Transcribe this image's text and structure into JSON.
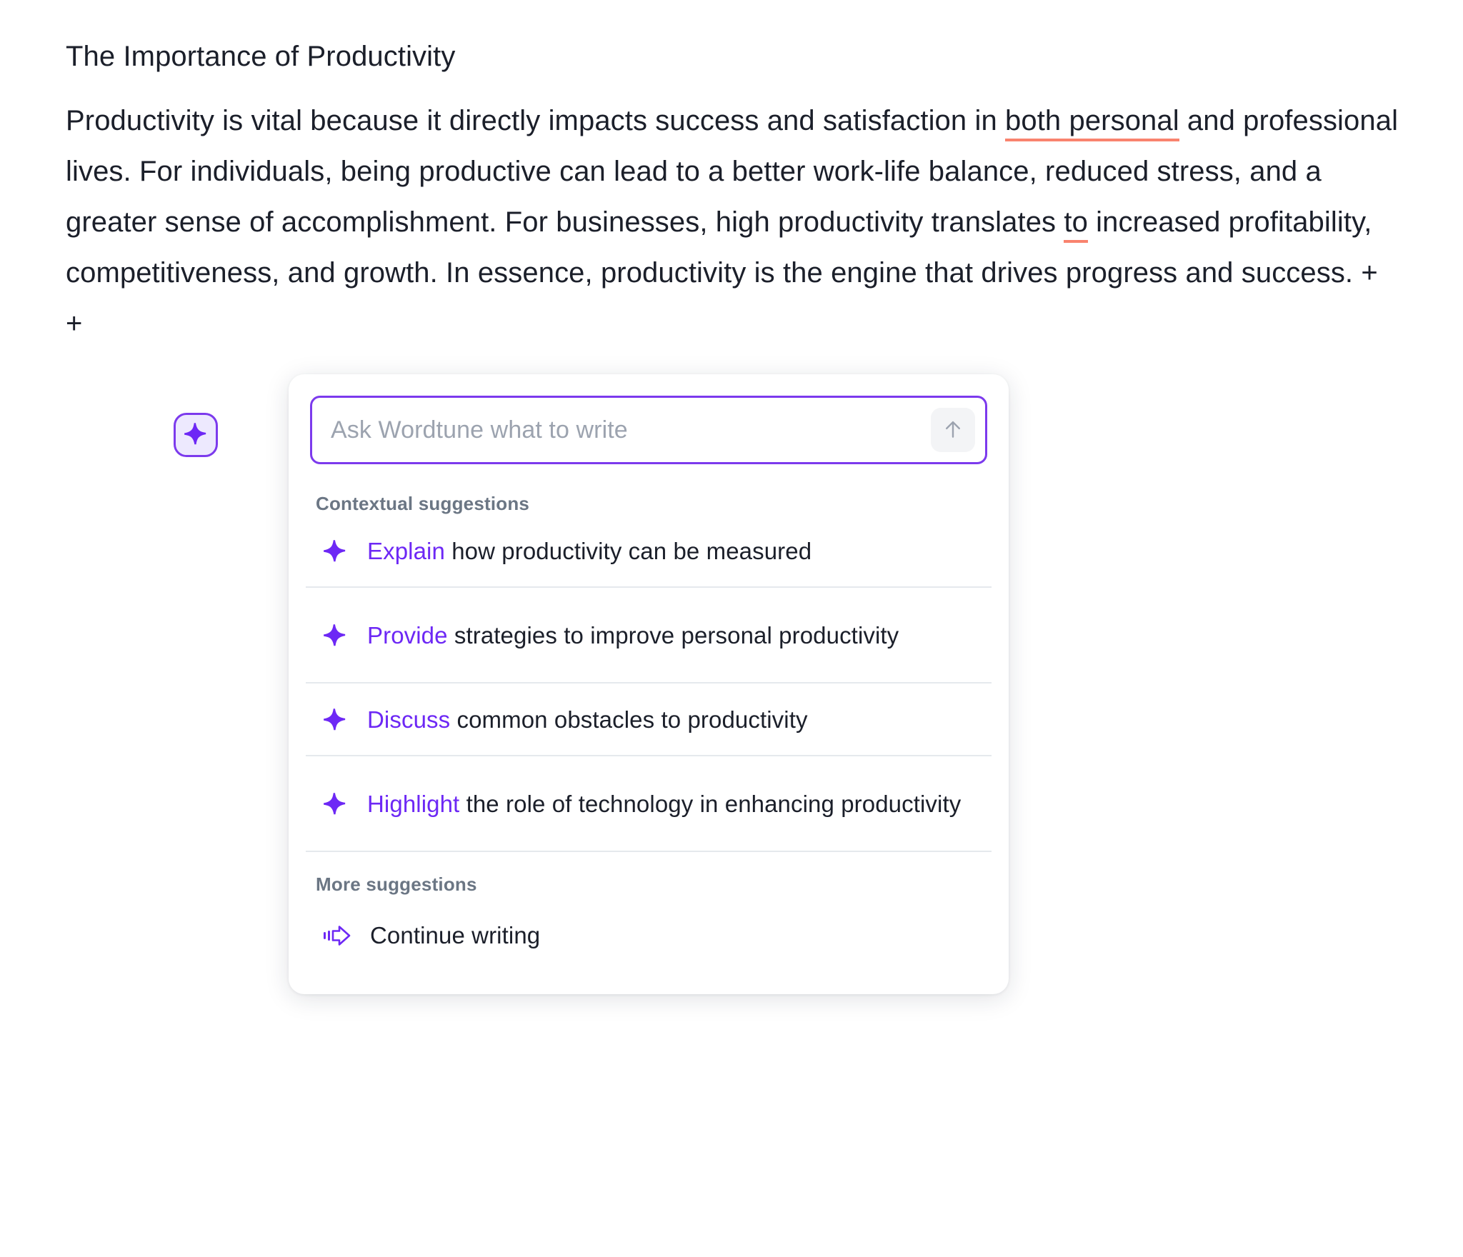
{
  "document": {
    "title": "The Importance of Productivity",
    "paragraph": {
      "part1": "Productivity is vital because it directly impacts success and satisfaction in ",
      "highlight1": "both personal",
      "part2": " and professional lives. For individuals, being productive can lead to a better work-life balance, reduced stress, and a greater sense of accomplishment. For businesses, high productivity translates ",
      "highlight2": "to",
      "part3": " increased profitability, competitiveness, and growth. In essence, productivity is the engine that drives progress and success. + +"
    },
    "suggestion_underline_color": "#f9836e"
  },
  "launcher": {
    "icon": "sparkle-icon",
    "border_color": "#7c3aed",
    "fill_color": "#ede9fe"
  },
  "popup": {
    "ask": {
      "placeholder": "Ask Wordtune what to write",
      "value": "",
      "send_icon": "arrow-up-icon",
      "border_color": "#7c3aed"
    },
    "contextual": {
      "heading": "Contextual suggestions",
      "items": [
        {
          "icon": "sparkle-icon",
          "verb": "Explain",
          "rest": " how productivity can be measured",
          "lines": 1
        },
        {
          "icon": "sparkle-icon",
          "verb": "Provide",
          "rest": " strategies to improve personal productivity",
          "lines": 2
        },
        {
          "icon": "sparkle-icon",
          "verb": "Discuss",
          "rest": " common obstacles to productivity",
          "lines": 1
        },
        {
          "icon": "sparkle-icon",
          "verb": "Highlight",
          "rest": " the role of technology in enhancing productivity",
          "lines": 2
        }
      ]
    },
    "more": {
      "heading": "More suggestions",
      "items": [
        {
          "icon": "continue-writing-icon",
          "label": "Continue writing"
        }
      ]
    },
    "accent_color": "#6d28f5"
  }
}
